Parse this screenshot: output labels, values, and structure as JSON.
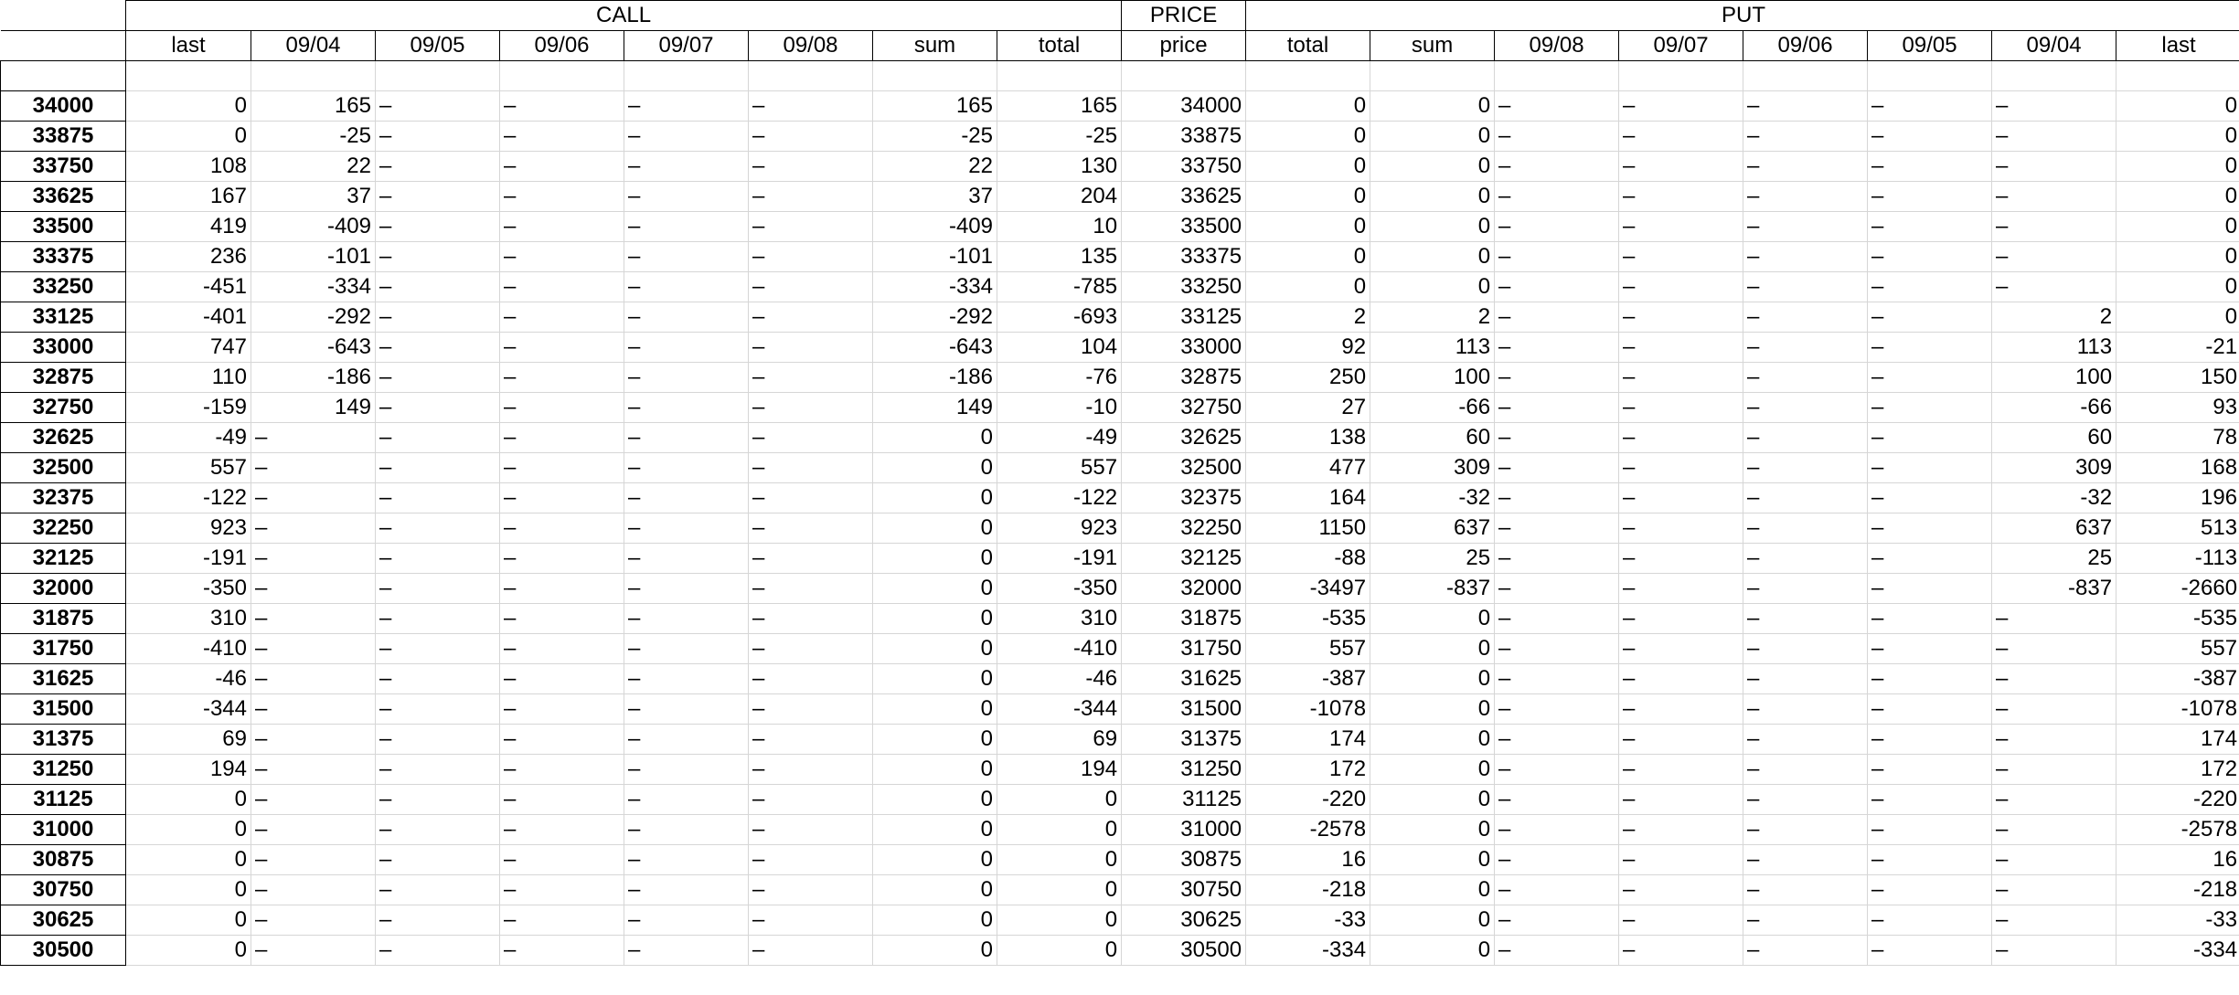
{
  "groups": {
    "call": "CALL",
    "price": "PRICE",
    "put": "PUT"
  },
  "columns": [
    "",
    "last",
    "09/04",
    "09/05",
    "09/06",
    "09/07",
    "09/08",
    "sum",
    "total",
    "price",
    "total",
    "sum",
    "09/08",
    "09/07",
    "09/06",
    "09/05",
    "09/04",
    "last"
  ],
  "rows": [
    [
      "34000",
      "0",
      "165",
      "–",
      "–",
      "–",
      "–",
      "165",
      "165",
      "34000",
      "0",
      "0",
      "–",
      "–",
      "–",
      "–",
      "–",
      "0"
    ],
    [
      "33875",
      "0",
      "-25",
      "–",
      "–",
      "–",
      "–",
      "-25",
      "-25",
      "33875",
      "0",
      "0",
      "–",
      "–",
      "–",
      "–",
      "–",
      "0"
    ],
    [
      "33750",
      "108",
      "22",
      "–",
      "–",
      "–",
      "–",
      "22",
      "130",
      "33750",
      "0",
      "0",
      "–",
      "–",
      "–",
      "–",
      "–",
      "0"
    ],
    [
      "33625",
      "167",
      "37",
      "–",
      "–",
      "–",
      "–",
      "37",
      "204",
      "33625",
      "0",
      "0",
      "–",
      "–",
      "–",
      "–",
      "–",
      "0"
    ],
    [
      "33500",
      "419",
      "-409",
      "–",
      "–",
      "–",
      "–",
      "-409",
      "10",
      "33500",
      "0",
      "0",
      "–",
      "–",
      "–",
      "–",
      "–",
      "0"
    ],
    [
      "33375",
      "236",
      "-101",
      "–",
      "–",
      "–",
      "–",
      "-101",
      "135",
      "33375",
      "0",
      "0",
      "–",
      "–",
      "–",
      "–",
      "–",
      "0"
    ],
    [
      "33250",
      "-451",
      "-334",
      "–",
      "–",
      "–",
      "–",
      "-334",
      "-785",
      "33250",
      "0",
      "0",
      "–",
      "–",
      "–",
      "–",
      "–",
      "0"
    ],
    [
      "33125",
      "-401",
      "-292",
      "–",
      "–",
      "–",
      "–",
      "-292",
      "-693",
      "33125",
      "2",
      "2",
      "–",
      "–",
      "–",
      "–",
      "2",
      "0"
    ],
    [
      "33000",
      "747",
      "-643",
      "–",
      "–",
      "–",
      "–",
      "-643",
      "104",
      "33000",
      "92",
      "113",
      "–",
      "–",
      "–",
      "–",
      "113",
      "-21"
    ],
    [
      "32875",
      "110",
      "-186",
      "–",
      "–",
      "–",
      "–",
      "-186",
      "-76",
      "32875",
      "250",
      "100",
      "–",
      "–",
      "–",
      "–",
      "100",
      "150"
    ],
    [
      "32750",
      "-159",
      "149",
      "–",
      "–",
      "–",
      "–",
      "149",
      "-10",
      "32750",
      "27",
      "-66",
      "–",
      "–",
      "–",
      "–",
      "-66",
      "93"
    ],
    [
      "32625",
      "-49",
      "–",
      "–",
      "–",
      "–",
      "–",
      "0",
      "-49",
      "32625",
      "138",
      "60",
      "–",
      "–",
      "–",
      "–",
      "60",
      "78"
    ],
    [
      "32500",
      "557",
      "–",
      "–",
      "–",
      "–",
      "–",
      "0",
      "557",
      "32500",
      "477",
      "309",
      "–",
      "–",
      "–",
      "–",
      "309",
      "168"
    ],
    [
      "32375",
      "-122",
      "–",
      "–",
      "–",
      "–",
      "–",
      "0",
      "-122",
      "32375",
      "164",
      "-32",
      "–",
      "–",
      "–",
      "–",
      "-32",
      "196"
    ],
    [
      "32250",
      "923",
      "–",
      "–",
      "–",
      "–",
      "–",
      "0",
      "923",
      "32250",
      "1150",
      "637",
      "–",
      "–",
      "–",
      "–",
      "637",
      "513"
    ],
    [
      "32125",
      "-191",
      "–",
      "–",
      "–",
      "–",
      "–",
      "0",
      "-191",
      "32125",
      "-88",
      "25",
      "–",
      "–",
      "–",
      "–",
      "25",
      "-113"
    ],
    [
      "32000",
      "-350",
      "–",
      "–",
      "–",
      "–",
      "–",
      "0",
      "-350",
      "32000",
      "-3497",
      "-837",
      "–",
      "–",
      "–",
      "–",
      "-837",
      "-2660"
    ],
    [
      "31875",
      "310",
      "–",
      "–",
      "–",
      "–",
      "–",
      "0",
      "310",
      "31875",
      "-535",
      "0",
      "–",
      "–",
      "–",
      "–",
      "–",
      "-535"
    ],
    [
      "31750",
      "-410",
      "–",
      "–",
      "–",
      "–",
      "–",
      "0",
      "-410",
      "31750",
      "557",
      "0",
      "–",
      "–",
      "–",
      "–",
      "–",
      "557"
    ],
    [
      "31625",
      "-46",
      "–",
      "–",
      "–",
      "–",
      "–",
      "0",
      "-46",
      "31625",
      "-387",
      "0",
      "–",
      "–",
      "–",
      "–",
      "–",
      "-387"
    ],
    [
      "31500",
      "-344",
      "–",
      "–",
      "–",
      "–",
      "–",
      "0",
      "-344",
      "31500",
      "-1078",
      "0",
      "–",
      "–",
      "–",
      "–",
      "–",
      "-1078"
    ],
    [
      "31375",
      "69",
      "–",
      "–",
      "–",
      "–",
      "–",
      "0",
      "69",
      "31375",
      "174",
      "0",
      "–",
      "–",
      "–",
      "–",
      "–",
      "174"
    ],
    [
      "31250",
      "194",
      "–",
      "–",
      "–",
      "–",
      "–",
      "0",
      "194",
      "31250",
      "172",
      "0",
      "–",
      "–",
      "–",
      "–",
      "–",
      "172"
    ],
    [
      "31125",
      "0",
      "–",
      "–",
      "–",
      "–",
      "–",
      "0",
      "0",
      "31125",
      "-220",
      "0",
      "–",
      "–",
      "–",
      "–",
      "–",
      "-220"
    ],
    [
      "31000",
      "0",
      "–",
      "–",
      "–",
      "–",
      "–",
      "0",
      "0",
      "31000",
      "-2578",
      "0",
      "–",
      "–",
      "–",
      "–",
      "–",
      "-2578"
    ],
    [
      "30875",
      "0",
      "–",
      "–",
      "–",
      "–",
      "–",
      "0",
      "0",
      "30875",
      "16",
      "0",
      "–",
      "–",
      "–",
      "–",
      "–",
      "16"
    ],
    [
      "30750",
      "0",
      "–",
      "–",
      "–",
      "–",
      "–",
      "0",
      "0",
      "30750",
      "-218",
      "0",
      "–",
      "–",
      "–",
      "–",
      "–",
      "-218"
    ],
    [
      "30625",
      "0",
      "–",
      "–",
      "–",
      "–",
      "–",
      "0",
      "0",
      "30625",
      "-33",
      "0",
      "–",
      "–",
      "–",
      "–",
      "–",
      "-33"
    ],
    [
      "30500",
      "0",
      "–",
      "–",
      "–",
      "–",
      "–",
      "0",
      "0",
      "30500",
      "-334",
      "0",
      "–",
      "–",
      "–",
      "–",
      "–",
      "-334"
    ]
  ]
}
